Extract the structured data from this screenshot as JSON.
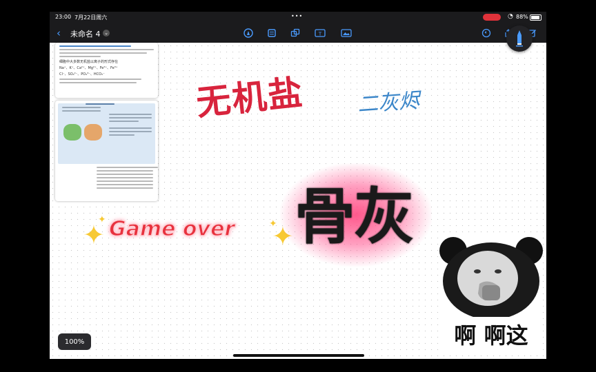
{
  "status": {
    "time": "23:00",
    "date": "7月22日周六",
    "battery": "88%",
    "icons": [
      "record-icon",
      "wifi-icon",
      "battery-icon"
    ]
  },
  "toolbar": {
    "title": "未命名 4",
    "icons": [
      "back-chevron-icon",
      "title-dropdown-icon",
      "pen-tool-icon",
      "notebook-icon",
      "shapes-icon",
      "text-box-icon",
      "image-icon",
      "undo-icon",
      "share-icon",
      "edit-icon"
    ]
  },
  "canvas": {
    "handwritten_title": "无机盐",
    "handwritten_note": "二灰烬",
    "game_over": "Game over",
    "big_text": "骨灰",
    "meme_caption": "啊 啊这",
    "zoom": "100%"
  },
  "textbook": {
    "paragraphs": [
      "细胞中大多数无机盐以离子的形式存在",
      "Na⁺、K⁺、Ca²⁺、Mg²⁺、Fe²⁺、Fe³⁺",
      "Cl⁻、SO₄²⁻、PO₄³⁻、HCO₃⁻"
    ]
  },
  "colors": {
    "accent_blue": "#4a9bff",
    "title_red": "#d8243d",
    "note_blue": "#3b86c9",
    "game_over_red": "#e8323e",
    "glow_pink": "#ff2a7a",
    "toolbar_bg": "#1b1b1d"
  }
}
